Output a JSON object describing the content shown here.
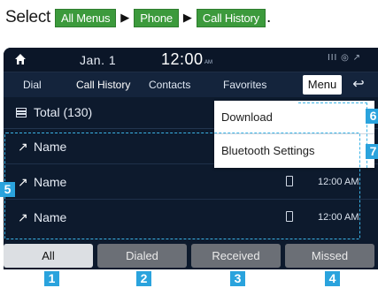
{
  "instruction": {
    "lead": "Select",
    "steps": [
      "All Menus",
      "Phone",
      "Call History"
    ],
    "arrow": "▶",
    "trailing": "."
  },
  "status_bar": {
    "date": "Jan. 1",
    "time": "12:00",
    "ampm": "AM",
    "icons": "III ◎ ↗"
  },
  "tabs": [
    "Dial",
    "Call History",
    "Contacts",
    "Favorites"
  ],
  "active_tab": "Call History",
  "menu_label": "Menu",
  "back_icon": "↩",
  "total_label": "Total (130)",
  "calls": [
    {
      "icon": "outgoing-call-icon",
      "glyph": "↗",
      "name": "Name",
      "time": ""
    },
    {
      "icon": "outgoing-call-icon",
      "glyph": "↗",
      "name": "Name",
      "time": "12:00 AM"
    },
    {
      "icon": "outgoing-call-icon",
      "glyph": "↗",
      "name": "Name",
      "time": "12:00 AM"
    }
  ],
  "dropdown": {
    "items": [
      "Download",
      "Bluetooth Settings"
    ]
  },
  "filter_tabs": [
    "All",
    "Dialed",
    "Received",
    "Missed"
  ],
  "selected_filter": "All",
  "badges": [
    "1",
    "2",
    "3",
    "4",
    "5",
    "6",
    "7"
  ],
  "colors": {
    "screen_bg": "#0d1a2d",
    "chip_green": "#3c9a3c",
    "badge_blue": "#2aa3dd",
    "highlight_dash": "#3bb3e6"
  }
}
